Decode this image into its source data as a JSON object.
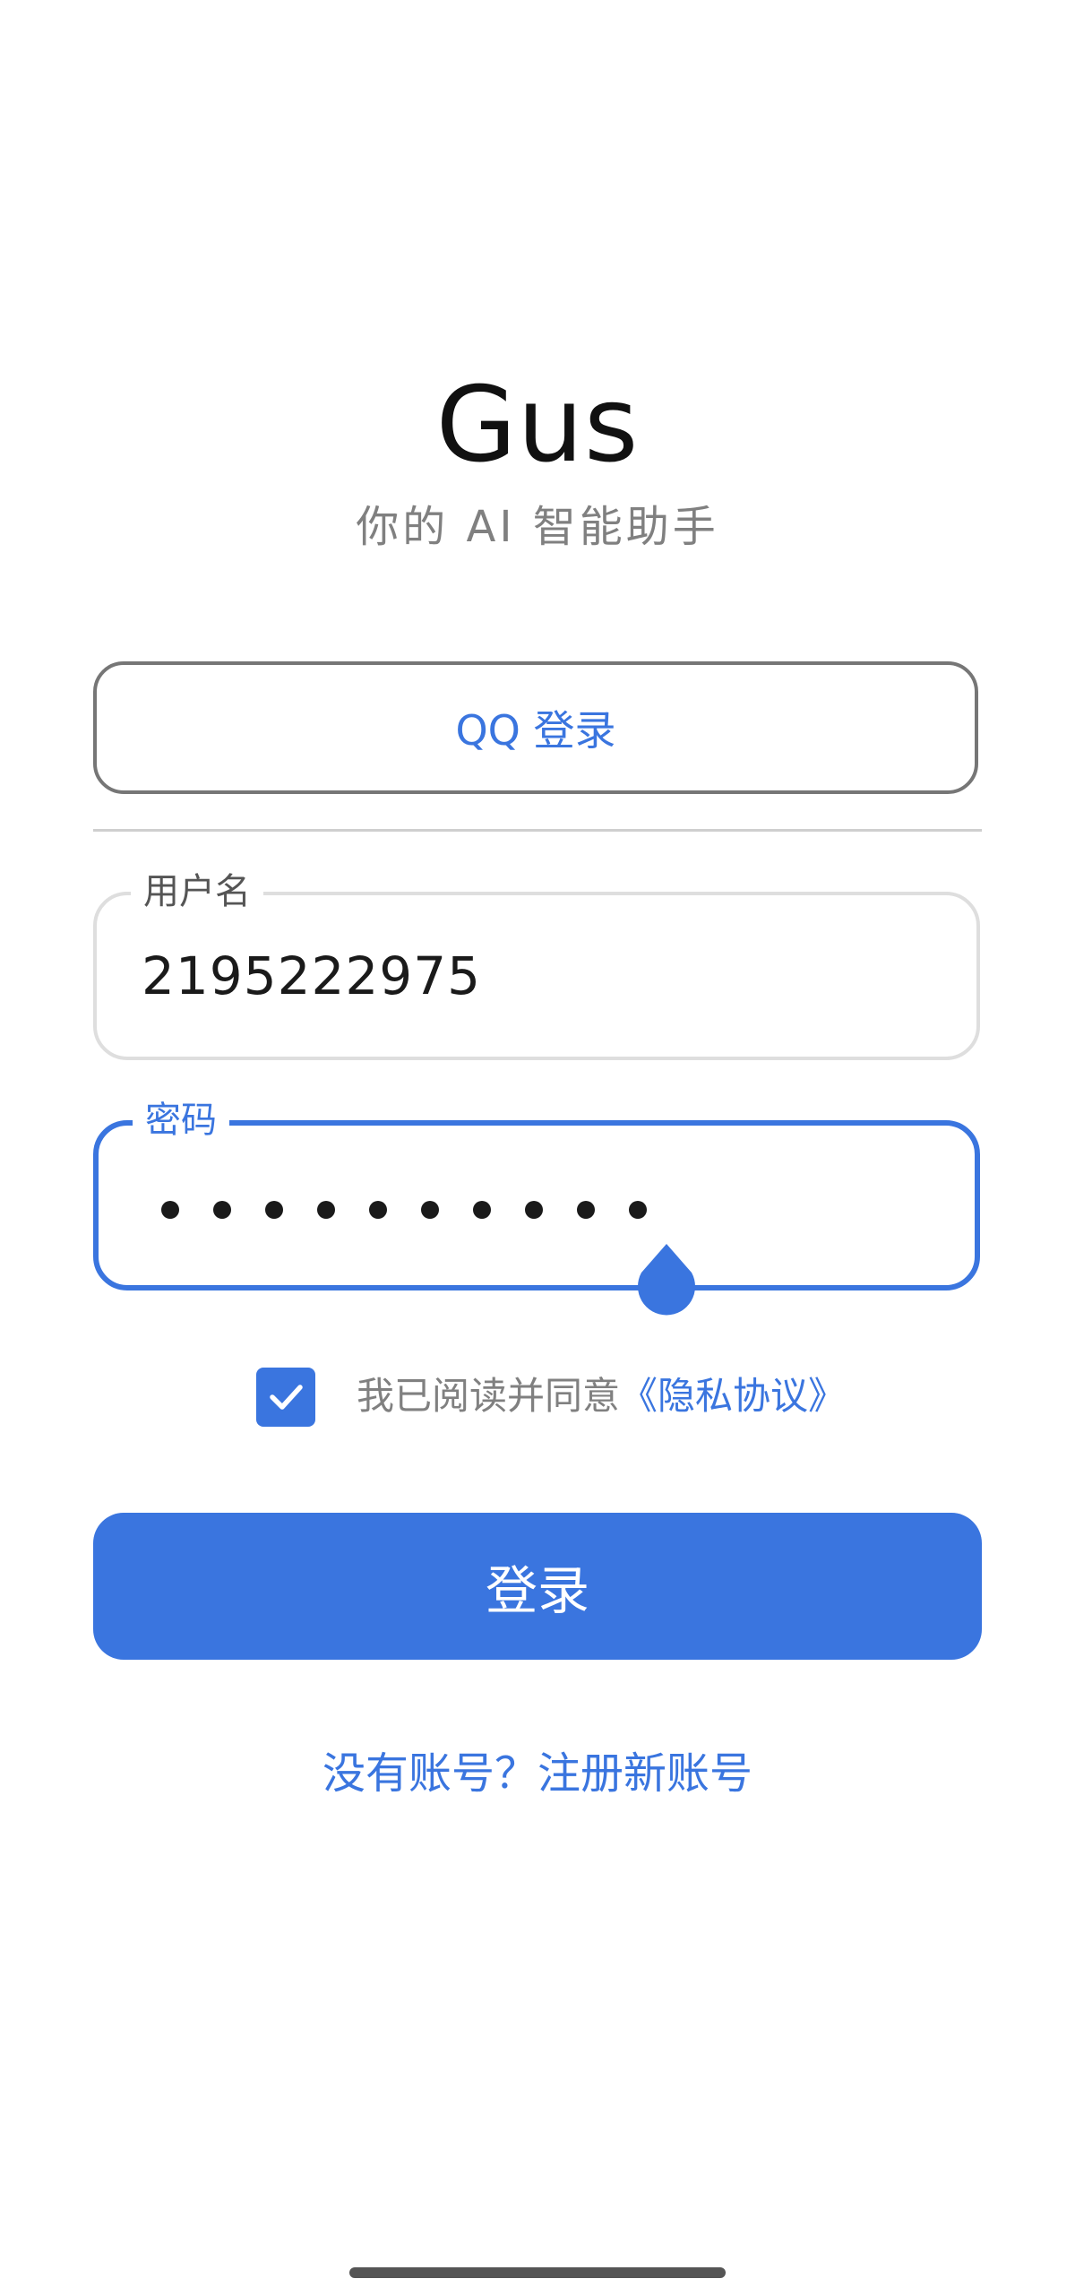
{
  "app": {
    "title": "Gus",
    "subtitle": "你的 AI 智能助手"
  },
  "qq_login": {
    "label": "QQ 登录"
  },
  "username": {
    "label": "用户名",
    "value": "2195222975"
  },
  "password": {
    "label": "密码",
    "masked_length": 10
  },
  "agreement": {
    "checked": true,
    "text": "我已阅读并同意",
    "link": "《隐私协议》"
  },
  "login_button": {
    "label": "登录"
  },
  "register": {
    "label": "没有账号？注册新账号"
  },
  "colors": {
    "accent": "#3a75df",
    "subtitle": "#808080",
    "border": "#dedede"
  }
}
